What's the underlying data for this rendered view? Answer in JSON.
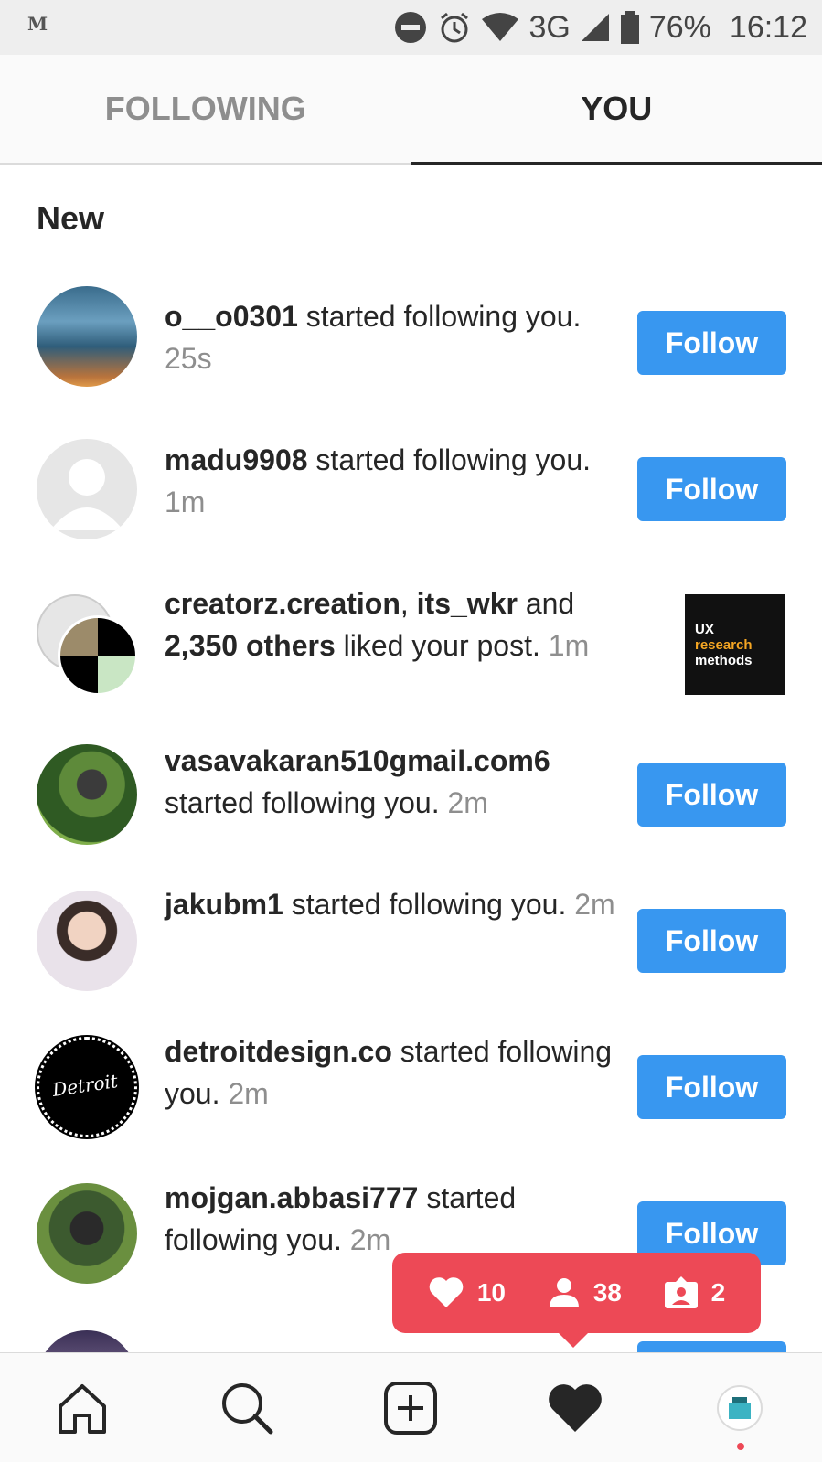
{
  "status_bar": {
    "left_label": "M",
    "battery": "76%",
    "time": "16:12",
    "network": "3G"
  },
  "tabs": {
    "following": "FOLLOWING",
    "you": "YOU"
  },
  "section_title": "New",
  "rows": [
    {
      "username": "o__o0301",
      "text": " started following you. ",
      "time": "25s",
      "button": "Follow"
    },
    {
      "username": "madu9908",
      "text": " started following you. ",
      "time": "1m",
      "button": "Follow"
    },
    {
      "username": "creatorz.creation",
      "sep": ", ",
      "username2": "its_wkr",
      "and": " and ",
      "others": "2,350 others",
      "text": " liked your post. ",
      "time": "1m",
      "thumb": {
        "line1": "UX",
        "line2": "research",
        "line3": "methods"
      }
    },
    {
      "username": "vasavakaran510gmail.com6",
      "text": " started following you. ",
      "time": "2m",
      "button": "Follow"
    },
    {
      "username": "jakubm1",
      "text": " started following you. ",
      "time": "2m",
      "button": "Follow"
    },
    {
      "username": "detroitdesign.co",
      "text": " started following you. ",
      "time": "2m",
      "button": "Follow",
      "logo_text": "Detroit"
    },
    {
      "username": "mojgan.abbasi777",
      "text": " started following you. ",
      "time": "2m",
      "button": "Follow"
    }
  ],
  "popup": {
    "likes": "10",
    "followers": "38",
    "tags": "2"
  },
  "colors": {
    "accent_blue": "#3897f0",
    "notification_red": "#ed4956"
  }
}
